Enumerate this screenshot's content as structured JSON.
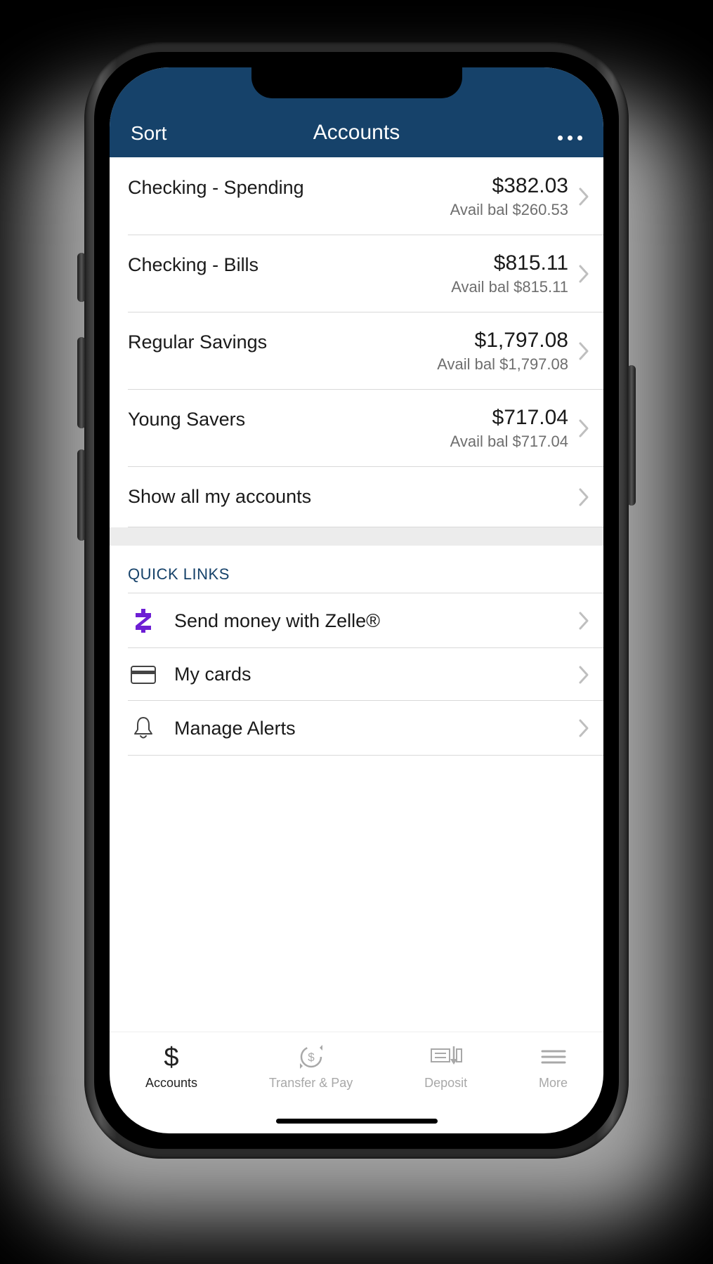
{
  "header": {
    "sort_label": "Sort",
    "title": "Accounts"
  },
  "accounts": [
    {
      "name": "Checking - Spending",
      "balance": "$382.03",
      "avail": "Avail bal $260.53"
    },
    {
      "name": "Checking - Bills",
      "balance": "$815.11",
      "avail": "Avail bal $815.11"
    },
    {
      "name": "Regular Savings",
      "balance": "$1,797.08",
      "avail": "Avail bal $1,797.08"
    },
    {
      "name": "Young Savers",
      "balance": "$717.04",
      "avail": "Avail bal $717.04"
    }
  ],
  "show_all_label": "Show all my accounts",
  "quick_links": {
    "title": "QUICK LINKS",
    "items": [
      {
        "label": "Send money with Zelle®"
      },
      {
        "label": "My cards"
      },
      {
        "label": "Manage Alerts"
      }
    ]
  },
  "tabs": [
    {
      "label": "Accounts"
    },
    {
      "label": "Transfer & Pay"
    },
    {
      "label": "Deposit"
    },
    {
      "label": "More"
    }
  ]
}
